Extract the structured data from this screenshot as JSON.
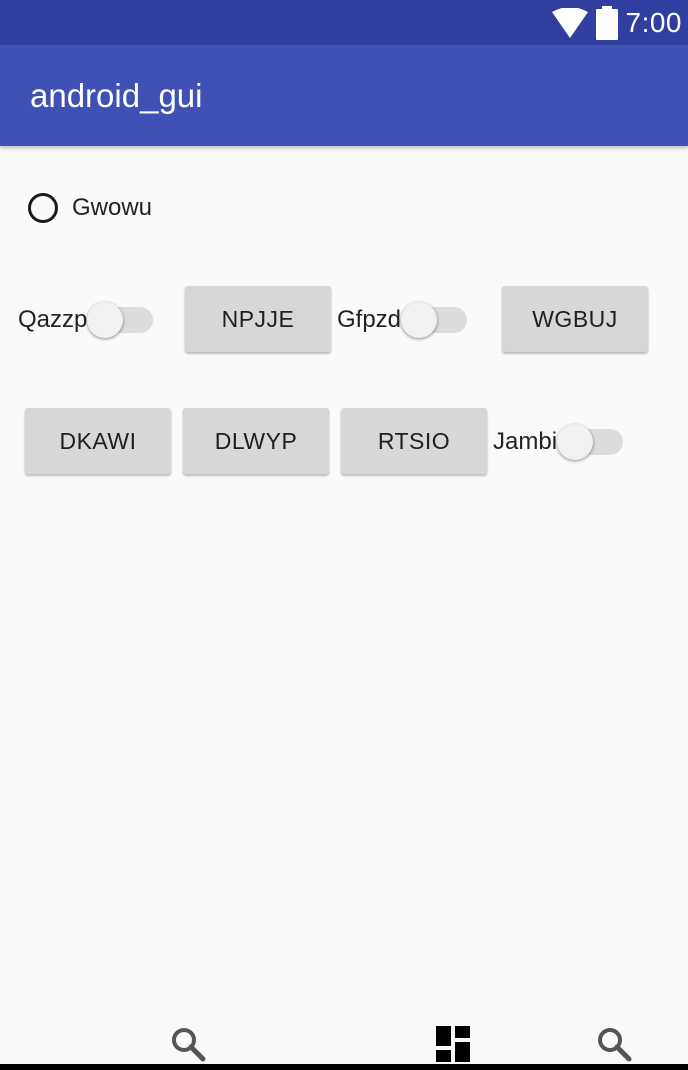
{
  "status_bar": {
    "time": "7:00",
    "icons": [
      "wifi-icon",
      "battery-icon"
    ],
    "background": "#303f9f"
  },
  "app_bar": {
    "title": "android_gui",
    "background": "#3f51b5"
  },
  "radio": {
    "label": "Gwowu",
    "checked": false
  },
  "switches": [
    {
      "label": "Qazzp",
      "on": false
    },
    {
      "label": "Gfpzd",
      "on": false
    },
    {
      "label": "Jambi",
      "on": false
    }
  ],
  "buttons": [
    {
      "label": "NPJJE"
    },
    {
      "label": "WGBUJ"
    },
    {
      "label": "DKAWI"
    },
    {
      "label": "DLWYP"
    },
    {
      "label": "RTSIO"
    }
  ],
  "nav_bar": {
    "icons": [
      "search-icon",
      "dashboard-icon",
      "search-icon"
    ]
  }
}
